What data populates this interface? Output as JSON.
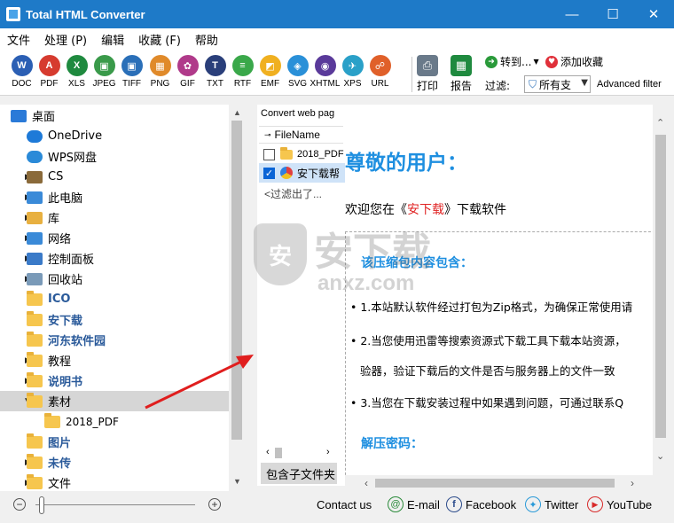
{
  "window": {
    "title": "Total HTML Converter",
    "minimize": "—",
    "maximize": "☐",
    "close": "✕"
  },
  "menu": [
    "文件",
    "处理 (P)",
    "编辑",
    "收藏 (F)",
    "帮助"
  ],
  "formats": [
    {
      "label": "DOC",
      "color": "#2b5fb4",
      "glyph": "W"
    },
    {
      "label": "PDF",
      "color": "#d63b2f",
      "glyph": "A"
    },
    {
      "label": "XLS",
      "color": "#1f8a3f",
      "glyph": "X"
    },
    {
      "label": "JPEG",
      "color": "#3a9a4a",
      "glyph": "▣"
    },
    {
      "label": "TIFF",
      "color": "#2a6fb8",
      "glyph": "▣"
    },
    {
      "label": "PNG",
      "color": "#e08a2a",
      "glyph": "▦"
    },
    {
      "label": "GIF",
      "color": "#b03a8a",
      "glyph": "✿"
    },
    {
      "label": "TXT",
      "color": "#2a3f7a",
      "glyph": "T"
    },
    {
      "label": "RTF",
      "color": "#3aa84a",
      "glyph": "≡"
    },
    {
      "label": "EMF",
      "color": "#f0b020",
      "glyph": "◩"
    },
    {
      "label": "SVG",
      "color": "#2a90d8",
      "glyph": "◈"
    },
    {
      "label": "XHTML",
      "color": "#5a3a9a",
      "glyph": "◉"
    },
    {
      "label": "XPS",
      "color": "#2aa0c8",
      "glyph": "✈"
    },
    {
      "label": "URL",
      "color": "#e0602a",
      "glyph": "☍"
    }
  ],
  "actions": {
    "print": "打印",
    "report": "报告",
    "goto": "转到...",
    "add_fav": "添加收藏",
    "filter_label": "过滤:",
    "filter_value": "所有支",
    "advanced_filter": "Advanced filter"
  },
  "tree": [
    {
      "label": "桌面",
      "icon": "desktop-icon",
      "arrow": "",
      "bold": false,
      "indent": 0
    },
    {
      "label": "OneDrive",
      "icon": "cloud-icon",
      "arrow": "",
      "bold": false,
      "indent": 1
    },
    {
      "label": "WPS网盘",
      "icon": "cloud-outline-icon",
      "arrow": "",
      "bold": false,
      "indent": 1
    },
    {
      "label": "CS",
      "icon": "user-icon",
      "arrow": "▶",
      "bold": false,
      "indent": 1
    },
    {
      "label": "此电脑",
      "icon": "computer-icon",
      "arrow": "▶",
      "bold": false,
      "indent": 1
    },
    {
      "label": "库",
      "icon": "library-icon",
      "arrow": "▶",
      "bold": false,
      "indent": 1
    },
    {
      "label": "网络",
      "icon": "network-icon",
      "arrow": "▶",
      "bold": false,
      "indent": 1
    },
    {
      "label": "控制面板",
      "icon": "control-panel-icon",
      "arrow": "▶",
      "bold": false,
      "indent": 1
    },
    {
      "label": "回收站",
      "icon": "recycle-bin-icon",
      "arrow": "▶",
      "bold": false,
      "indent": 1
    },
    {
      "label": "ICO",
      "icon": "folder-icon",
      "arrow": "",
      "bold": true,
      "indent": 1
    },
    {
      "label": "安下载",
      "icon": "folder-icon",
      "arrow": "",
      "bold": true,
      "indent": 1
    },
    {
      "label": "河东软件园",
      "icon": "folder-icon",
      "arrow": "",
      "bold": true,
      "indent": 1
    },
    {
      "label": "教程",
      "icon": "folder-icon",
      "arrow": "▶",
      "bold": false,
      "indent": 1
    },
    {
      "label": "说明书",
      "icon": "folder-icon",
      "arrow": "▶",
      "bold": true,
      "indent": 1
    },
    {
      "label": "素材",
      "icon": "folder-icon",
      "arrow": "▼",
      "bold": false,
      "indent": 1,
      "selected": true
    },
    {
      "label": "2018_PDF",
      "icon": "folder-icon",
      "arrow": "",
      "bold": false,
      "indent": 2
    },
    {
      "label": "图片",
      "icon": "folder-icon",
      "arrow": "",
      "bold": true,
      "indent": 1
    },
    {
      "label": "未传",
      "icon": "folder-icon",
      "arrow": "▶",
      "bold": true,
      "indent": 1
    },
    {
      "label": "文件",
      "icon": "folder-icon",
      "arrow": "▶",
      "bold": false,
      "indent": 1
    }
  ],
  "list": {
    "tab": "Convert web pag",
    "column": "FileName",
    "rows": [
      {
        "name": "2018_PDF",
        "checked": false,
        "icon": "folder-icon"
      },
      {
        "name": "安下载帮",
        "checked": true,
        "icon": "html-file-icon"
      }
    ],
    "filtered": "<过滤出了...",
    "subfolder_btn": "包含子文件夹"
  },
  "preview": {
    "heading": "尊敬的用户：",
    "welcome_pre": "欢迎您在《",
    "welcome_site": "安下载",
    "welcome_post": "》下载软件",
    "section": "该压缩包内容包含：",
    "bullets": [
      "1.本站默认软件经过打包为Zip格式，为确保正常使用请",
      "2.当您使用迅雷等搜索资源式下载工具下载本站资源，",
      "验器，验证下载后的文件是否与服务器上的文件一致",
      "3.当您在下载安装过程中如果遇到问题，可通过联系Q"
    ],
    "password_title": "解压密码："
  },
  "watermark": {
    "shield": "安",
    "text": "安下载",
    "sub": "anxz.com"
  },
  "bottom": {
    "contact": "Contact us",
    "email": "E-mail",
    "facebook": "Facebook",
    "twitter": "Twitter",
    "youtube": "YouTube"
  }
}
